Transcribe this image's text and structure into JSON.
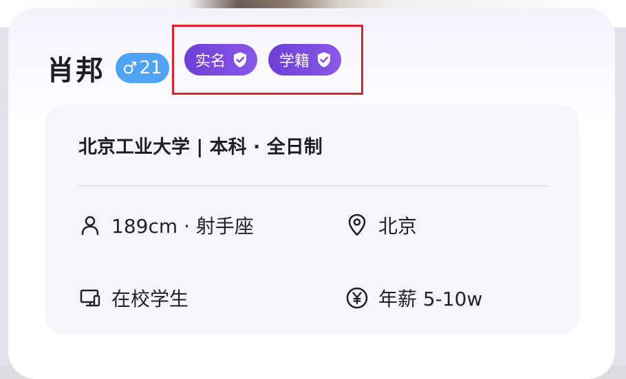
{
  "profile": {
    "name": "肖邦",
    "gender_symbol": "♂",
    "age": "21"
  },
  "verifications": [
    {
      "label": "实名",
      "icon": "shield-check-icon"
    },
    {
      "label": "学籍",
      "icon": "shield-check-icon"
    }
  ],
  "education": "北京工业大学 | 本科 · 全日制",
  "details": {
    "height_sign": {
      "text": "189cm · 射手座",
      "icon": "person-icon"
    },
    "location": {
      "text": "北京",
      "icon": "location-pin-icon"
    },
    "occupation": {
      "text": "在校学生",
      "icon": "desktop-icon"
    },
    "salary": {
      "text": "年薪 5-10w",
      "icon": "yen-circle-icon"
    }
  },
  "colors": {
    "gender_badge": "#4fa3f4",
    "verify_badge": "#7a4ae0",
    "highlight_box": "#e0202c"
  }
}
